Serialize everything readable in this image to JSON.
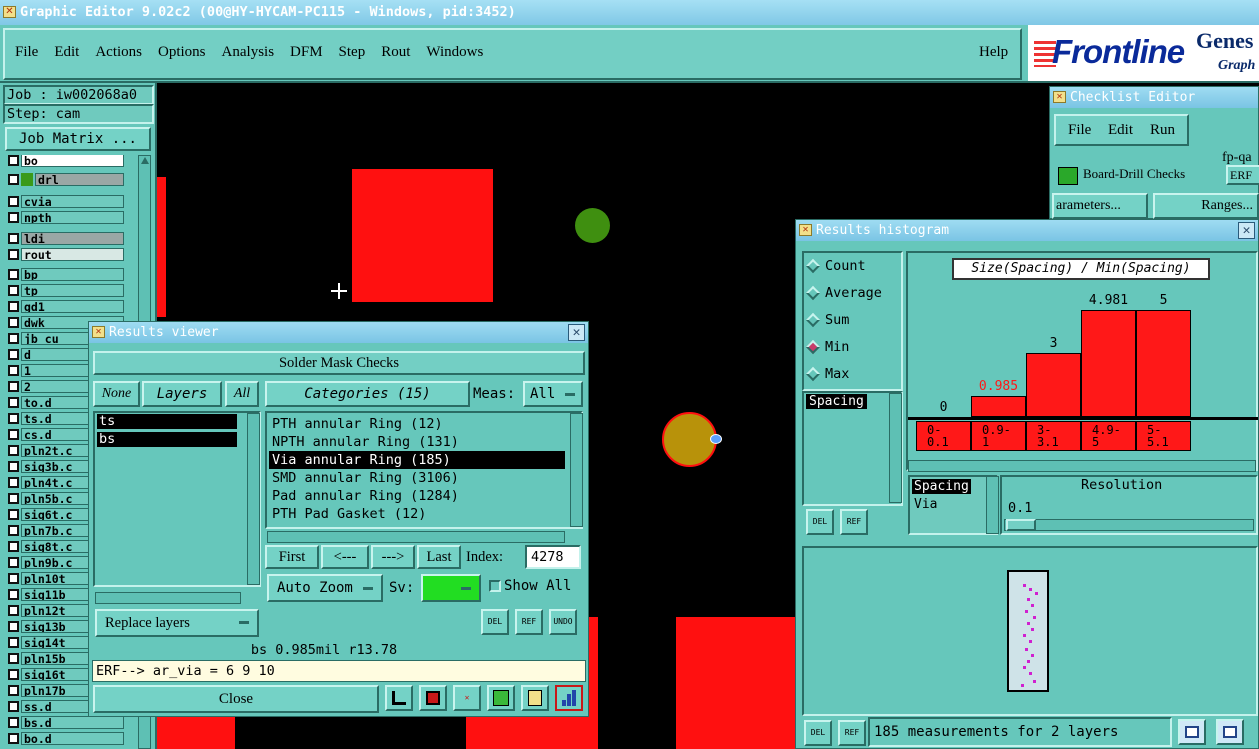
{
  "window_title": "Graphic Editor 9.02c2 (00@HY-HYCAM-PC115 - Windows, pid:3452)",
  "menu": [
    "File",
    "Edit",
    "Actions",
    "Options",
    "Analysis",
    "DFM",
    "Step",
    "Rout",
    "Windows"
  ],
  "help_label": "Help",
  "brand": {
    "name": "Frontline",
    "genesis": "Genes",
    "graphic": "Graph"
  },
  "job": {
    "job_label": "Job : iw002068a0",
    "step_label": "Step: cam",
    "matrix_button": "Job Matrix ..."
  },
  "layers": [
    {
      "name": "bo",
      "color": "#ffffff"
    },
    {
      "name": "drl",
      "color": "#9aa7a5",
      "swatch": "#3a9a1a"
    },
    {
      "name": "cvia",
      "color": "#6fcabe"
    },
    {
      "name": "npth",
      "color": "#6fcabe"
    },
    {
      "name": "ldi",
      "color": "#9aa7a5"
    },
    {
      "name": "rout",
      "color": "#d8e8e4"
    },
    {
      "name": "bp",
      "color": "#6fcabe"
    },
    {
      "name": "tp",
      "color": "#6fcabe"
    },
    {
      "name": "gd1",
      "color": "#6fcabe"
    },
    {
      "name": "dwk",
      "color": "#6fcabe"
    },
    {
      "name": "jb_cu",
      "color": "#6fcabe"
    },
    {
      "name": "d",
      "color": "#6fcabe"
    },
    {
      "name": "1",
      "color": "#6fcabe"
    },
    {
      "name": "2",
      "color": "#6fcabe"
    },
    {
      "name": "to.d",
      "color": "#6fcabe"
    },
    {
      "name": "ts.d",
      "color": "#6fcabe"
    },
    {
      "name": "cs.d",
      "color": "#6fcabe"
    },
    {
      "name": "pln2t.c",
      "color": "#6fcabe"
    },
    {
      "name": "sig3b.c",
      "color": "#6fcabe"
    },
    {
      "name": "pln4t.c",
      "color": "#6fcabe"
    },
    {
      "name": "pln5b.c",
      "color": "#6fcabe"
    },
    {
      "name": "sig6t.c",
      "color": "#6fcabe"
    },
    {
      "name": "pln7b.c",
      "color": "#6fcabe"
    },
    {
      "name": "sig8t.c",
      "color": "#6fcabe"
    },
    {
      "name": "pln9b.c",
      "color": "#6fcabe"
    },
    {
      "name": "pln10t",
      "color": "#6fcabe"
    },
    {
      "name": "sig11b",
      "color": "#6fcabe"
    },
    {
      "name": "pln12t",
      "color": "#6fcabe"
    },
    {
      "name": "sig13b",
      "color": "#6fcabe"
    },
    {
      "name": "sig14t",
      "color": "#6fcabe"
    },
    {
      "name": "pln15b",
      "color": "#6fcabe"
    },
    {
      "name": "sig16t",
      "color": "#6fcabe"
    },
    {
      "name": "pln17b",
      "color": "#6fcabe"
    },
    {
      "name": "ss.d",
      "color": "#6fcabe"
    },
    {
      "name": "bs.d",
      "color": "#6fcabe"
    },
    {
      "name": "bo.d",
      "color": "#6fcabe"
    }
  ],
  "checklist": {
    "title": "Checklist Editor",
    "menu": [
      "File",
      "Edit",
      "Run"
    ],
    "name": "fp-qa",
    "row": "Board-Drill Checks",
    "erf": "ERF",
    "params_button": "arameters...",
    "ranges_button": "Ranges..."
  },
  "histogram": {
    "title": "Results histogram",
    "options": [
      "Count",
      "Average",
      "Sum",
      "Min",
      "Max"
    ],
    "selected_option": "Min",
    "chart_title": "Size(Spacing) / Min(Spacing)",
    "list_items": [
      "Spacing"
    ],
    "spacing_list": [
      "Spacing",
      "Via"
    ],
    "resolution_label": "Resolution",
    "resolution_value": "0.1",
    "del_label": "DEL",
    "ref_label": "REF",
    "status": "185 measurements for 2 layers"
  },
  "chart_data": {
    "type": "bar",
    "title": "Size(Spacing) / Min(Spacing)",
    "categories": [
      "0-\n0.1",
      "0.9-\n1",
      "3-\n3.1",
      "4.9-\n5",
      "5-\n5.1"
    ],
    "values": [
      0,
      0.985,
      3,
      4.981,
      5
    ],
    "value_labels": [
      "0",
      "0.985",
      "3",
      "4.981",
      "5"
    ],
    "highlight_index": 1,
    "highlight_color": "#ff1818",
    "bar_color": "#ff1818"
  },
  "results_viewer": {
    "title": "Results viewer",
    "header": "Solder Mask Checks",
    "none_button": "None",
    "layers_button": "Layers",
    "all_button": "All",
    "layers": [
      "ts",
      "bs"
    ],
    "categories_button": "Categories (15)",
    "meas_label": "Meas:",
    "meas_value": "All",
    "categories": [
      "PTH annular Ring (12)",
      "NPTH annular Ring (131)",
      "Via annular Ring (185)",
      "SMD annular Ring (3106)",
      "Pad annular Ring (1284)",
      "PTH Pad Gasket (12)"
    ],
    "selected_category": 2,
    "first": "First",
    "prev": "<---",
    "next": "--->",
    "last": "Last",
    "index_label": "Index:",
    "index_value": "4278",
    "auto_zoom": "Auto Zoom",
    "sv_label": "Sv:",
    "show_all": "Show All",
    "replace_layers": "Replace layers",
    "del_label": "DEL",
    "ref_label": "REF",
    "undo_label": "UNDO",
    "status_line": "bs 0.985mil  r13.78",
    "erf_line": "ERF--> ar_via = 6 9 10",
    "close": "Close"
  },
  "colors": {
    "accent_red": "#ff1818",
    "panel_teal": "#66c7bb",
    "title_blue": "#8ccfea",
    "pad_gold": "#b8920a",
    "via_green": "#3f8f10"
  }
}
